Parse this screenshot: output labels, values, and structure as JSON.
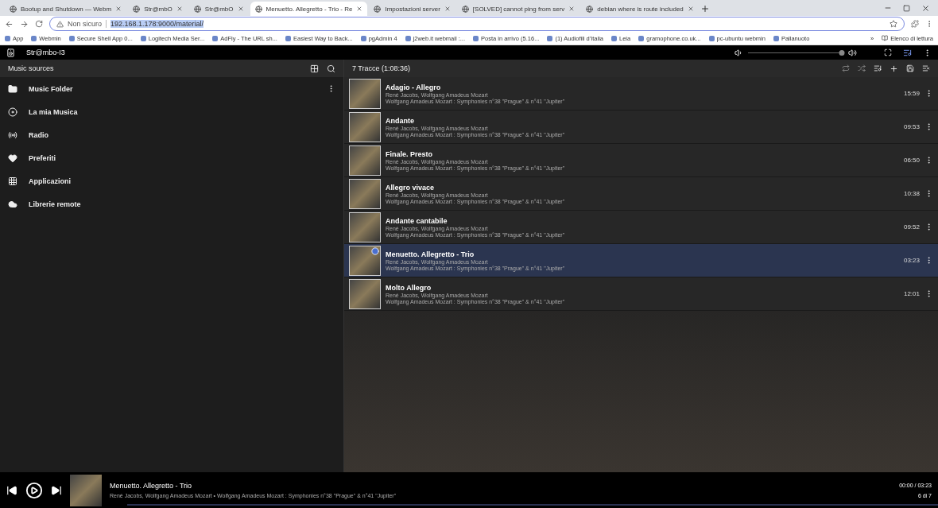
{
  "browser": {
    "tabs": [
      {
        "label": "Bootup and Shutdown — Webm",
        "selected": false
      },
      {
        "label": "Str@mbO",
        "selected": false
      },
      {
        "label": "Str@mbO",
        "selected": false
      },
      {
        "label": "Menuetto. Allegretto - Trio - Re",
        "selected": true
      },
      {
        "label": "Impostazioni server",
        "selected": false
      },
      {
        "label": "[SOLVED] cannot ping from serv",
        "selected": false
      },
      {
        "label": "debian where is route included",
        "selected": false
      }
    ],
    "security": "Non sicuro",
    "url": "192.168.1.178:9000/material/",
    "bookmarks": [
      "App",
      "Webmin",
      "Secure Shell App 0...",
      "Logitech Media Ser...",
      "AdFly - The URL sh...",
      "Easiest Way to Back...",
      "pgAdmin 4",
      "j2web.it webmail :...",
      "Posta in arrivo (5.16...",
      "(1) Audiofili d'Italia",
      "Leia",
      "gramophone.co.uk...",
      "pc-ubuntu webmin",
      "Pallanuoto"
    ],
    "more": "»",
    "reading_list": "Elenco di lettura"
  },
  "app": {
    "player_name": "Str@mbo-I3",
    "volume": {
      "level": 0.98
    }
  },
  "sidebar": {
    "title": "Music sources",
    "items": [
      {
        "label": "Music Folder",
        "kind": "folder"
      },
      {
        "label": "La mia Musica",
        "kind": "library"
      },
      {
        "label": "Radio",
        "kind": "radio"
      },
      {
        "label": "Preferiti",
        "kind": "heart"
      },
      {
        "label": "Applicazioni",
        "kind": "apps"
      },
      {
        "label": "Librerie remote",
        "kind": "cloud"
      }
    ]
  },
  "queue": {
    "title": "7 Tracce (1:08:36)",
    "tracks": [
      {
        "title": "Adagio - Allegro",
        "artist": "René Jacobs, Wolfgang Amadeus Mozart",
        "album": "Wolfgang Amadeus Mozart : Symphonies n°38 \"Prague\" & n°41 \"Jupiter\"",
        "duration": "15:59",
        "selected": false
      },
      {
        "title": "Andante",
        "artist": "René Jacobs, Wolfgang Amadeus Mozart",
        "album": "Wolfgang Amadeus Mozart : Symphonies n°38 \"Prague\" & n°41 \"Jupiter\"",
        "duration": "09:53",
        "selected": false
      },
      {
        "title": "Finale. Presto",
        "artist": "René Jacobs, Wolfgang Amadeus Mozart",
        "album": "Wolfgang Amadeus Mozart : Symphonies n°38 \"Prague\" & n°41 \"Jupiter\"",
        "duration": "06:50",
        "selected": false
      },
      {
        "title": "Allegro vivace",
        "artist": "René Jacobs, Wolfgang Amadeus Mozart",
        "album": "Wolfgang Amadeus Mozart : Symphonies n°38 \"Prague\" & n°41 \"Jupiter\"",
        "duration": "10:38",
        "selected": false
      },
      {
        "title": "Andante cantabile",
        "artist": "René Jacobs, Wolfgang Amadeus Mozart",
        "album": "Wolfgang Amadeus Mozart : Symphonies n°38 \"Prague\" & n°41 \"Jupiter\"",
        "duration": "09:52",
        "selected": false
      },
      {
        "title": "Menuetto. Allegretto - Trio",
        "artist": "René Jacobs, Wolfgang Amadeus Mozart",
        "album": "Wolfgang Amadeus Mozart : Symphonies n°38 \"Prague\" & n°41 \"Jupiter\"",
        "duration": "03:23",
        "selected": true
      },
      {
        "title": "Molto Allegro",
        "artist": "René Jacobs, Wolfgang Amadeus Mozart",
        "album": "Wolfgang Amadeus Mozart : Symphonies n°38 \"Prague\" & n°41 \"Jupiter\"",
        "duration": "12:01",
        "selected": false
      }
    ]
  },
  "now_playing": {
    "title": "Menuetto. Allegretto - Trio",
    "details": "René Jacobs, Wolfgang Amadeus Mozart • Wolfgang Amadeus Mozart : Symphonies n°38 \"Prague\" & n°41 \"Jupiter\"",
    "time": "00:00 / 03:23",
    "position": "6 di 7",
    "progress": {
      "level": 0.0
    }
  }
}
